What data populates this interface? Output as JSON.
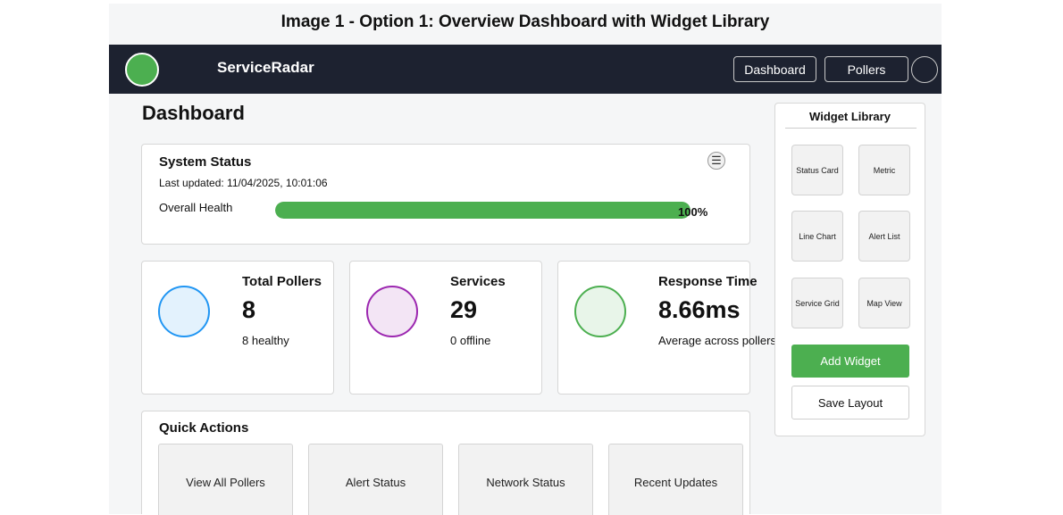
{
  "caption": "Image 1 - Option 1: Overview Dashboard with Widget Library",
  "topnav": {
    "brand": "ServiceRadar",
    "links": [
      "Dashboard",
      "Pollers"
    ]
  },
  "page_title": "Dashboard",
  "system_status": {
    "title": "System Status",
    "last_updated": "Last updated: 11/04/2025, 10:01:06",
    "menu_icon": "hamburger-menu-icon",
    "health_label": "Overall Health",
    "health_percent": 100,
    "health_text": "100%"
  },
  "metrics": [
    {
      "title": "Total Pollers",
      "value": "8",
      "sub": "8 healthy",
      "circle_fill": "#e3f2fd",
      "circle_border": "#2196f3"
    },
    {
      "title": "Services",
      "value": "29",
      "sub": "0 offline",
      "circle_fill": "#f3e5f5",
      "circle_border": "#9c27b0"
    },
    {
      "title": "Response Time",
      "value": "8.66ms",
      "sub": "Average across pollers",
      "circle_fill": "#e8f5e9",
      "circle_border": "#4caf50"
    }
  ],
  "quick_actions": {
    "title": "Quick Actions",
    "buttons": [
      "View All Pollers",
      "Alert Status",
      "Network Status",
      "Recent Updates"
    ]
  },
  "widget_library": {
    "title": "Widget Library",
    "items": [
      "Status Card",
      "Metric",
      "Line Chart",
      "Alert List",
      "Service Grid",
      "Map View"
    ],
    "add_label": "Add Widget",
    "save_label": "Save Layout"
  },
  "colors": {
    "accent": "#4caf50",
    "nav_bg": "#1d2230"
  }
}
